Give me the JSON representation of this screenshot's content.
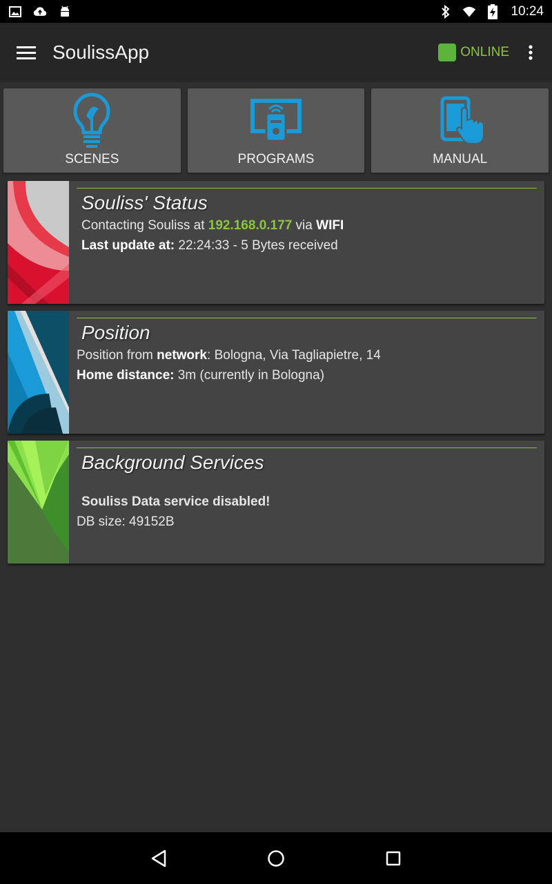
{
  "status_bar": {
    "time": "10:24",
    "icons": [
      "image-icon",
      "cloud-upload-icon",
      "android-icon",
      "bluetooth-icon",
      "wifi-icon",
      "battery-charging-icon"
    ]
  },
  "app_bar": {
    "title": "SoulissApp",
    "status_label": "ONLINE",
    "status_color": "#5cb43c"
  },
  "tiles": [
    {
      "label": "SCENES",
      "icon": "lightbulb-icon"
    },
    {
      "label": "PROGRAMS",
      "icon": "remote-screen-icon"
    },
    {
      "label": "MANUAL",
      "icon": "tablet-touch-icon"
    }
  ],
  "cards": {
    "status": {
      "title": "Souliss' Status",
      "contacting_prefix": "Contacting Souliss at ",
      "ip": "192.168.0.177",
      "via": " via ",
      "network": "WIFI",
      "last_update_label": "Last update at:",
      "last_update_value": " 22:24:33 - 5 Bytes received"
    },
    "position": {
      "title": "Position",
      "position_prefix": "Position from ",
      "position_source": "network",
      "position_value": ": Bologna, Via Tagliapietre, 14",
      "home_distance_label": "Home distance:",
      "home_distance_value": " 3m (currently in Bologna)"
    },
    "services": {
      "title": "Background Services",
      "service_status": "Souliss Data service disabled!",
      "db_size": "DB size: 49152B"
    }
  },
  "colors": {
    "accent_green": "#8cc63f",
    "icon_blue": "#1a9ad6"
  }
}
